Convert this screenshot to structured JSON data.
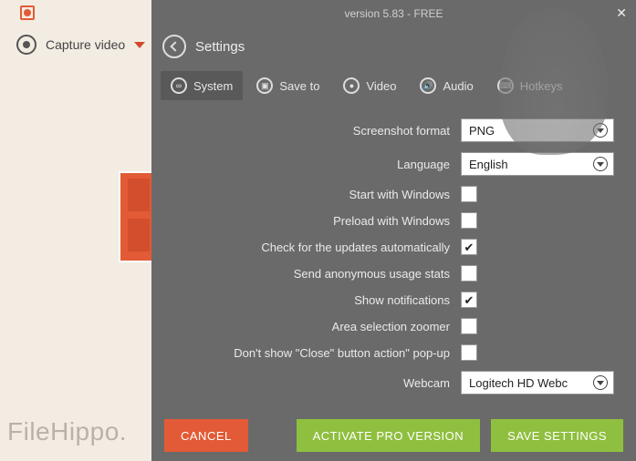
{
  "titlebar": {
    "text": "version 5.83 - FREE"
  },
  "sidebar": {
    "capture_label": "Capture video"
  },
  "header": {
    "title": "Settings"
  },
  "tabs": {
    "system": "System",
    "save_to": "Save to",
    "video": "Video",
    "audio": "Audio",
    "hotkeys": "Hotkeys"
  },
  "form": {
    "screenshot_format": {
      "label": "Screenshot format",
      "value": "PNG"
    },
    "language": {
      "label": "Language",
      "value": "English"
    },
    "start_with_windows": {
      "label": "Start with Windows",
      "checked": false
    },
    "preload_with_windows": {
      "label": "Preload with Windows",
      "checked": false
    },
    "check_updates": {
      "label": "Check for the updates automatically",
      "checked": true
    },
    "usage_stats": {
      "label": "Send anonymous usage stats",
      "checked": false
    },
    "show_notifications": {
      "label": "Show notifications",
      "checked": true
    },
    "area_zoomer": {
      "label": "Area selection zoomer",
      "checked": false
    },
    "dont_show_close": {
      "label": "Don't show \"Close\" button action\" pop-up",
      "checked": false
    },
    "webcam": {
      "label": "Webcam",
      "value": "Logitech HD Webc"
    }
  },
  "footer": {
    "cancel": "CANCEL",
    "activate": "ACTIVATE PRO VERSION",
    "save": "SAVE SETTINGS"
  },
  "watermark": "FileHippo."
}
